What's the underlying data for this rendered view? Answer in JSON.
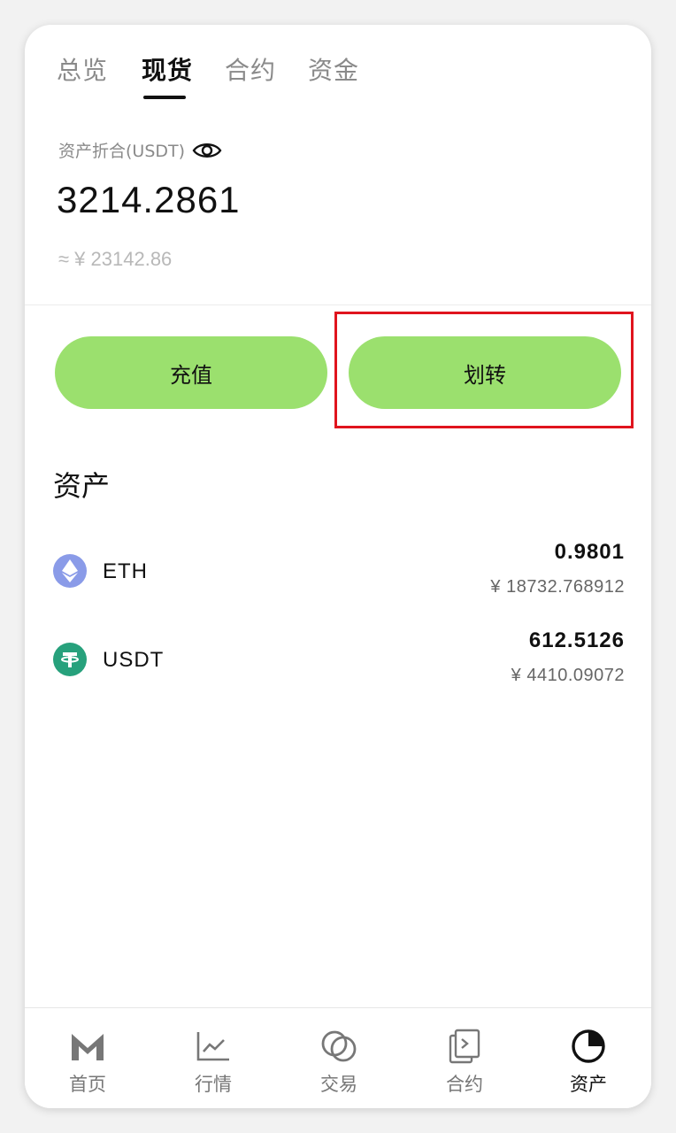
{
  "tabs": [
    {
      "label": "总览",
      "active": false
    },
    {
      "label": "现货",
      "active": true
    },
    {
      "label": "合约",
      "active": false
    },
    {
      "label": "资金",
      "active": false
    }
  ],
  "balance": {
    "label": "资产折合(USDT)",
    "value": "3214.2861",
    "cny": "≈ ¥ 23142.86"
  },
  "actions": {
    "deposit_label": "充值",
    "transfer_label": "划转"
  },
  "assets": {
    "title": "资产",
    "items": [
      {
        "symbol": "ETH",
        "amount": "0.9801",
        "cny": "¥ 18732.768912",
        "icon": "eth-icon"
      },
      {
        "symbol": "USDT",
        "amount": "612.5126",
        "cny": "¥ 4410.09072",
        "icon": "usdt-icon"
      }
    ]
  },
  "bottom_nav": [
    {
      "label": "首页",
      "icon": "home-m-icon",
      "active": false
    },
    {
      "label": "行情",
      "icon": "market-chart-icon",
      "active": false
    },
    {
      "label": "交易",
      "icon": "trade-coins-icon",
      "active": false
    },
    {
      "label": "合约",
      "icon": "contract-doc-icon",
      "active": false
    },
    {
      "label": "资产",
      "icon": "assets-pie-icon",
      "active": true
    }
  ],
  "colors": {
    "accent_button": "#9be06e",
    "highlight_border": "#e0141e",
    "eth_icon": "#8a9be8",
    "usdt_icon": "#27a17c"
  }
}
